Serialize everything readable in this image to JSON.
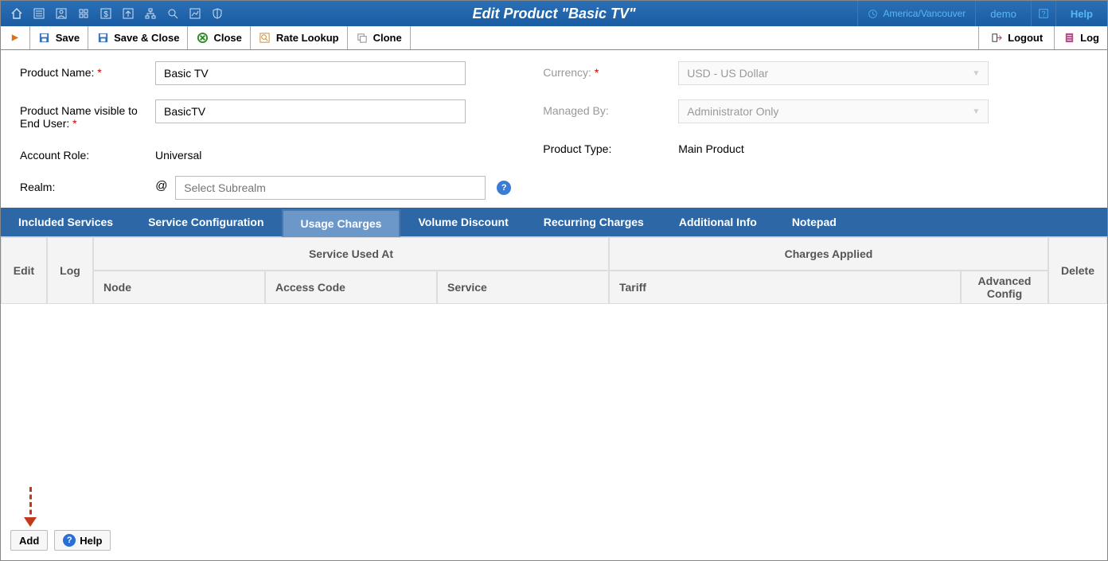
{
  "header": {
    "title": "Edit Product \"Basic TV\"",
    "timezone": "America/Vancouver",
    "demo_link": "demo",
    "help_link": "Help"
  },
  "toolbar": {
    "save": "Save",
    "save_close": "Save & Close",
    "close": "Close",
    "rate_lookup": "Rate Lookup",
    "clone": "Clone",
    "logout": "Logout",
    "log": "Log"
  },
  "form": {
    "product_name_label": "Product Name:",
    "product_name_value": "Basic TV",
    "enduser_label": "Product Name visible to End User:",
    "enduser_value": "BasicTV",
    "account_role_label": "Account Role:",
    "account_role_value": "Universal",
    "realm_label": "Realm:",
    "realm_placeholder": "Select Subrealm",
    "currency_label": "Currency:",
    "currency_value": "USD - US Dollar",
    "managed_by_label": "Managed By:",
    "managed_by_value": "Administrator Only",
    "product_type_label": "Product Type:",
    "product_type_value": "Main Product"
  },
  "tabs": {
    "included_services": "Included Services",
    "service_config": "Service Configuration",
    "usage_charges": "Usage Charges",
    "volume_discount": "Volume Discount",
    "recurring_charges": "Recurring Charges",
    "additional_info": "Additional Info",
    "notepad": "Notepad"
  },
  "grid": {
    "edit": "Edit",
    "log": "Log",
    "service_used_at": "Service Used At",
    "charges_applied": "Charges Applied",
    "node": "Node",
    "access_code": "Access Code",
    "service": "Service",
    "tariff": "Tariff",
    "advanced_config": "Advanced Config",
    "delete": "Delete"
  },
  "footer": {
    "add": "Add",
    "help": "Help"
  }
}
